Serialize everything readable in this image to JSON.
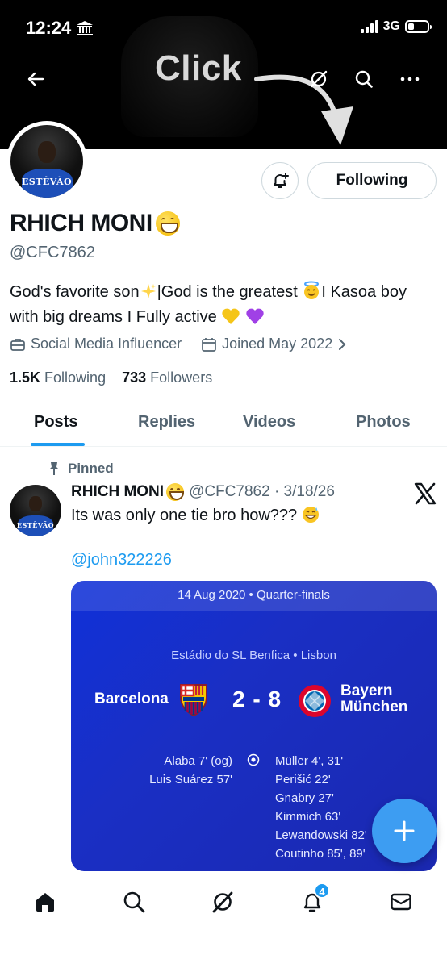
{
  "status_bar": {
    "time": "12:24",
    "network": "3G",
    "battery_level": 0.3
  },
  "annotation": {
    "click_text": "Click"
  },
  "header": {
    "back_icon": "back-arrow-icon",
    "grok_icon": "grok-icon",
    "search_icon": "search-icon",
    "more_icon": "more-icon"
  },
  "profile": {
    "avatar_text": "ESTÊVÃO",
    "following_label": "Following",
    "display_name": "RHICH MONI",
    "handle": "@CFC7862",
    "bio": {
      "part1": "God's favorite son",
      "part2": "|God is the greatest ",
      "part3": "I Kasoa boy with big dreams I Fully active "
    },
    "category": "Social Media Influencer",
    "joined": "Joined May 2022",
    "following_count": "1.5K",
    "following_label_text": "Following",
    "followers_count": "733",
    "followers_label_text": "Followers"
  },
  "tabs": [
    {
      "label": "Posts",
      "active": true
    },
    {
      "label": "Replies",
      "active": false
    },
    {
      "label": "Videos",
      "active": false
    },
    {
      "label": "Photos",
      "active": false
    }
  ],
  "post": {
    "pinned_label": "Pinned",
    "author": "RHICH MONI",
    "meta": "@CFC7862 · 3/18/26",
    "text": "Its was only one tie bro how???",
    "mention": "@john322226",
    "media": {
      "date_line": "14 Aug 2020  •  Quarter-finals",
      "venue": "Estádio do SL Benfica  •  Lisbon",
      "home_team": "Barcelona",
      "score": "2 - 8",
      "away_team_line1": "Bayern",
      "away_team_line2": "München",
      "home_scorers": [
        "Alaba 7' (og)",
        "Luis Suárez 57'"
      ],
      "away_scorers": [
        "Müller 4', 31'",
        "Perišić 22'",
        "Gnabry 27'",
        "Kimmich 63'",
        "Lewandowski 82'",
        "Coutinho 85', 89'"
      ]
    }
  },
  "fab": {
    "icon": "plus-icon"
  },
  "bottom_nav": {
    "items": [
      "home-icon",
      "search-icon",
      "grok-icon",
      "notifications-icon",
      "messages-icon"
    ],
    "notification_count": "4"
  },
  "colors": {
    "accent": "#1d9bf0",
    "text": "#0f1419",
    "secondary_text": "#536471",
    "media_blue": "#1a2fc4"
  }
}
